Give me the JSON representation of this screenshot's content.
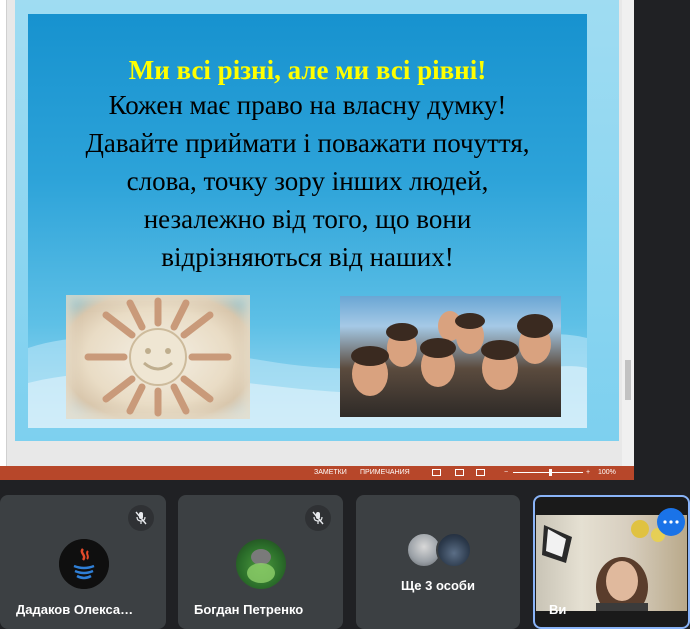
{
  "slide": {
    "headline": "Ми всі різні, але ми всі рівні!",
    "body": "Кожен має право на власну думку! Давайте приймати і поважати почуття, слова, точку зору інших людей, незалежно від того, що вони відрізняються від наших!"
  },
  "ppt_status": {
    "notes": "ЗАМЕТКИ",
    "comments": "ПРИМЕЧАНИЯ",
    "zoom_minus": "−",
    "zoom_plus": "+",
    "zoom_level": "100%"
  },
  "participants": [
    {
      "name": "Дадаков Олекса…",
      "muted": true,
      "avatar_icon": "java-logo-icon"
    },
    {
      "name": "Богдан Петренко",
      "muted": true,
      "avatar_icon": "photo-avatar"
    },
    {
      "name": "Ще 3 особи",
      "muted": false
    },
    {
      "name": "Ви",
      "muted": false
    }
  ],
  "colors": {
    "headline": "#ffff00",
    "statusbar": "#b7472a",
    "tile_bg": "#3c4043",
    "accent": "#1a73e8"
  }
}
